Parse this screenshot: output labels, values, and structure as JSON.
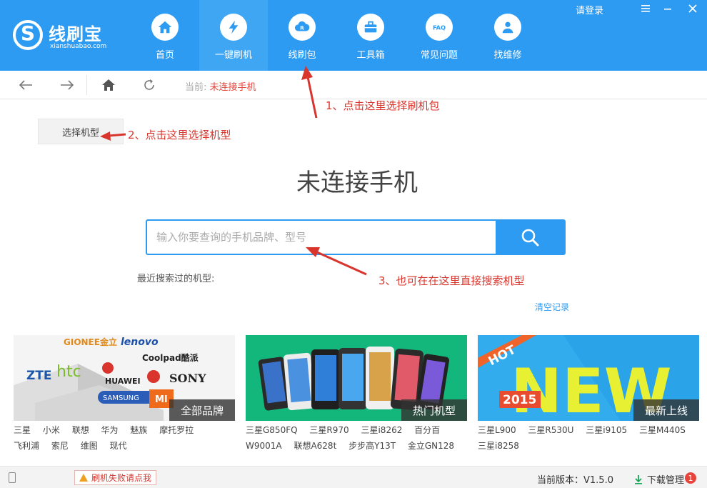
{
  "app": {
    "name": "线刷宝",
    "domain": "xianshuabao.com"
  },
  "header": {
    "login": "请登录",
    "nav": [
      {
        "label": "首页",
        "icon": "home-icon"
      },
      {
        "label": "一键刷机",
        "icon": "lightning-icon",
        "active": true
      },
      {
        "label": "线刷包",
        "icon": "cloud-package-icon"
      },
      {
        "label": "工具箱",
        "icon": "toolbox-icon"
      },
      {
        "label": "常见问题",
        "icon": "faq-icon"
      },
      {
        "label": "找维修",
        "icon": "repair-person-icon"
      }
    ]
  },
  "toolbar": {
    "crumb_prefix": "当前:",
    "crumb_value": "未连接手机"
  },
  "main": {
    "select_model": "选择机型",
    "title": "未连接手机",
    "search_placeholder": "输入你要查询的手机品牌、型号",
    "recent_label": "最近搜索过的机型:",
    "clear_label": "清空记录"
  },
  "annotations": {
    "a1": "1、点击这里选择刷机包",
    "a2": "2、点击这里选择机型",
    "a3": "3、也可在在这里直接搜索机型"
  },
  "cards": [
    {
      "tag": "全部品牌",
      "logos": [
        "GIONEE金立",
        "lenovo",
        "Coolpad酷派",
        "ZTE",
        "htc",
        "HUAWEI",
        "SONY",
        "SAMSUNG",
        "MI"
      ],
      "links": [
        "三星",
        "小米",
        "联想",
        "华为",
        "魅族",
        "摩托罗拉",
        "飞利浦",
        "索尼",
        "维图",
        "现代"
      ]
    },
    {
      "tag": "热门机型",
      "links": [
        "三星G850FQ",
        "三星R970",
        "三星i8262",
        "百分百",
        "W9001A",
        "联想A628t",
        "步步高Y13T",
        "金立GN128"
      ]
    },
    {
      "tag": "最新上线",
      "art_hot": "HOT",
      "art_new": "NEW",
      "art_year": "2015",
      "links": [
        "三星L900",
        "三星R530U",
        "三星i9105",
        "三星M440S",
        "三星i8258"
      ]
    }
  ],
  "status": {
    "fail_label": "刷机失败请点我",
    "version_label": "当前版本：V1.5.0",
    "download_label": "下载管理",
    "download_count": "1"
  },
  "colors": {
    "brand": "#2e9bf2",
    "annotation": "#d9352d"
  }
}
